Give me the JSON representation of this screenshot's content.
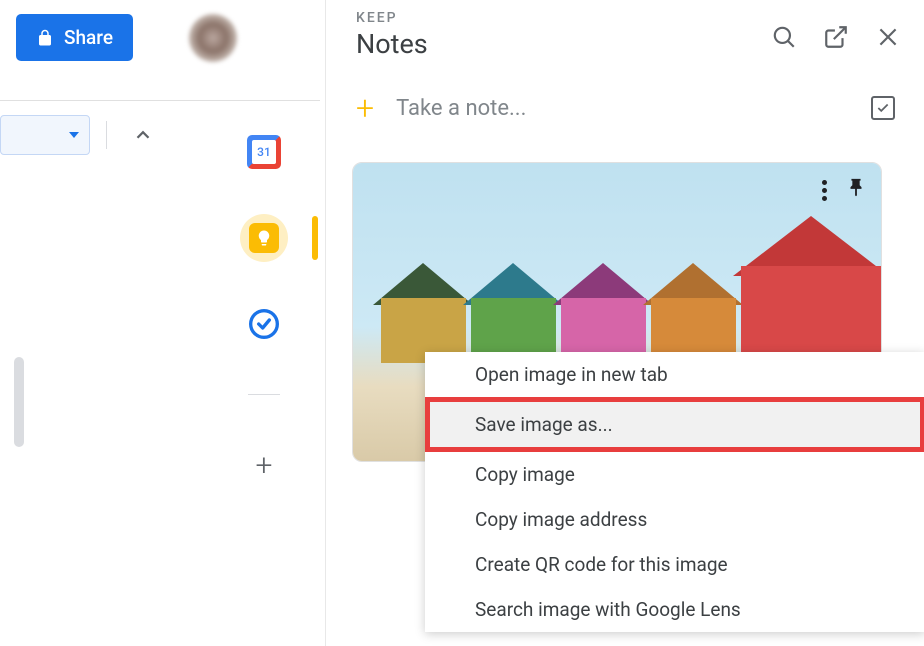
{
  "share_button": "Share",
  "calendar_date": "31",
  "panel": {
    "brand": "KEEP",
    "title": "Notes",
    "take_note_placeholder": "Take a note..."
  },
  "context_menu": [
    "Open image in new tab",
    "Save image as...",
    "Copy image",
    "Copy image address",
    "Create QR code for this image",
    "Search image with Google Lens"
  ],
  "highlighted_menu_index": 1
}
